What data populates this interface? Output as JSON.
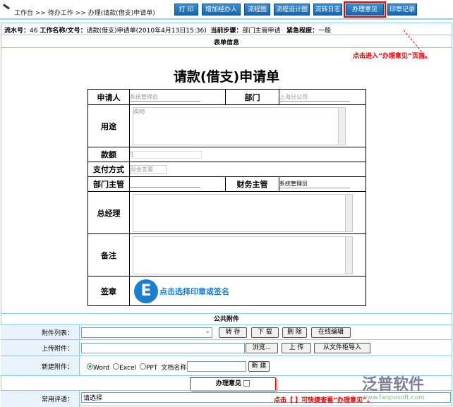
{
  "breadcrumb": {
    "items": [
      "工作台",
      ">>",
      "待办工作",
      ">>",
      "办理(请款(借支)申请单)"
    ]
  },
  "toolbar": [
    "打 印",
    "增加经办人",
    "流程图",
    "流程设计图",
    "流转日志",
    "办理意见",
    "印章记录"
  ],
  "info": {
    "serial_label": "流水号：",
    "serial": "46",
    "name_label": "工作名称/文号：",
    "name": "请款(借支)申请单(2010年4月13日15:36)",
    "step_label": "当前步骤：",
    "step": "部门主管申请",
    "urgency_label": "紧急程度：",
    "urgency": "一般"
  },
  "section_form": "表单信息",
  "annotation_top": "点击进入“办理意见”页面。",
  "form": {
    "title": "请款(借支)申请单",
    "applicant_label": "申请人",
    "applicant": "系统管理员",
    "dept_label": "部门",
    "dept": "上海分公司",
    "purpose_label": "用途",
    "purpose": "购物",
    "amount_label": "款额",
    "amount": "1",
    "pay_label": "支付方式",
    "pay": "现金支票",
    "mgr_label": "部门主管",
    "fin_label": "财务主管",
    "fin": "系统管理员",
    "gm_label": "总经理",
    "remark_label": "备注",
    "seal_label": "签章",
    "seal_icon_letter": "E",
    "seal_text": "点击选择印章或签名"
  },
  "attach": {
    "title": "公共附件",
    "list_label": "附件列表：",
    "save": "转 存",
    "download": "下 载",
    "delete": "删 除",
    "online_edit": "在线编辑",
    "upload_label": "上传附件：",
    "browse": "浏览...",
    "upload": "上 传",
    "import": "从文件柜导入",
    "new_label": "新建附件：",
    "types": [
      "Word",
      "Excel",
      "PPT"
    ],
    "docname_label": "文档名称：",
    "create": "新 建"
  },
  "opinion": {
    "label": "办理意见",
    "comment_label": "常用评语：",
    "comment_value": "请选择"
  },
  "annotation_bottom": "点击【  】可快捷查看“办理意见”。",
  "watermark": {
    "brand": "泛普软件",
    "url": "www.fanpusoft.com"
  }
}
